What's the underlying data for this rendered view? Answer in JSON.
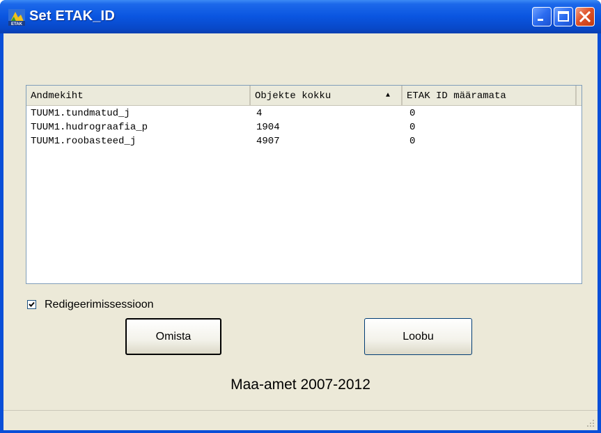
{
  "window": {
    "title": "Set ETAK_ID",
    "icon": "etak-app-icon",
    "controls": [
      "minimize-icon",
      "maximize-icon",
      "close-icon"
    ]
  },
  "table": {
    "columns": [
      {
        "label": "Andmekiht",
        "sorted": false
      },
      {
        "label": "Objekte kokku",
        "sorted": true,
        "sort_indicator": "▲"
      },
      {
        "label": "ETAK ID määramata",
        "sorted": false
      }
    ],
    "rows": [
      {
        "layer": "TUUM1.tundmatud_j",
        "total": "4",
        "unassigned": "0"
      },
      {
        "layer": "TUUM1.hudrograafia_p",
        "total": "1904",
        "unassigned": "0"
      },
      {
        "layer": "TUUM1.roobasteed_j",
        "total": "4907",
        "unassigned": "0"
      }
    ]
  },
  "options": {
    "edit_session_label": "Redigeerimissessioon",
    "edit_session_checked": true
  },
  "buttons": {
    "ok_label": "Omista",
    "cancel_label": "Loobu"
  },
  "footer": {
    "copyright": "Maa-amet 2007-2012"
  },
  "colors": {
    "titlebar": "#0a55e0",
    "client_bg": "#ece9d8",
    "close_button": "#e0532a"
  }
}
